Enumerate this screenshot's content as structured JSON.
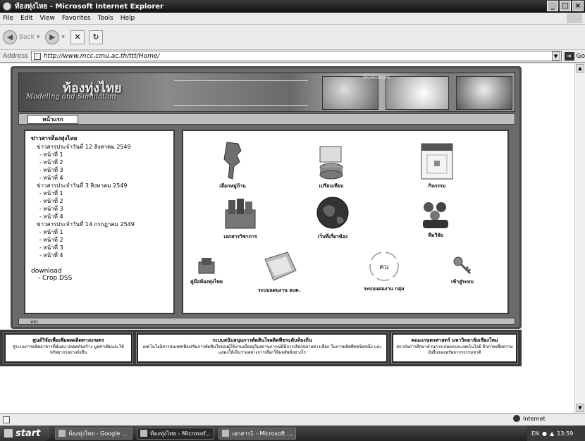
{
  "window": {
    "title": "ท้องทุ่งไทย - Microsoft Internet Explorer",
    "controls": [
      "_",
      "□",
      "×"
    ]
  },
  "menu": [
    "File",
    "Edit",
    "View",
    "Favorites",
    "Tools",
    "Help"
  ],
  "toolbar": {
    "back_label": "Back",
    "forward_label": ""
  },
  "address": {
    "label": "Address",
    "url": "http://www.mcc.cmu.ac.th/ttt/Home/",
    "go_label": "Go"
  },
  "site": {
    "banner_title": "ท้องทุ่งไทย",
    "banner_subtitle": "Modeling and Simulation",
    "banner_tag": "WORKSHOPS",
    "nav_home": "หน้าแรก",
    "news_title": "ข่าวสารท้องทุ่งไทย",
    "news": [
      {
        "issue": "ข่าวสารประจำวันที่ 12 สิงหาคม 2549",
        "pages": [
          "- หน้าที่ 1",
          "- หน้าที่ 2",
          "- หน้าที่ 3",
          "- หน้าที่ 4"
        ]
      },
      {
        "issue": "ข่าวสารประจำวันที่ 3 สิงหาคม 2549",
        "pages": [
          "- หน้าที่ 1",
          "- หน้าที่ 2",
          "- หน้าที่ 3",
          "- หน้าที่ 4"
        ]
      },
      {
        "issue": "ข่าวสารประจำวันที่ 14 กรกฎาคม 2549",
        "pages": [
          "- หน้าที่ 1",
          "- หน้าที่ 2",
          "- หน้าที่ 3",
          "- หน้าที่ 4"
        ]
      }
    ],
    "download_title": "download",
    "download_items": [
      "- Crop DSS"
    ],
    "icons": [
      {
        "label": "เลือกหมู่บ้าน",
        "icon": "thailand-map-icon"
      },
      {
        "label": "เปรียบเทียบ",
        "icon": "database-icon"
      },
      {
        "label": "กิจกรรม",
        "icon": "calendar-icon"
      },
      {
        "label": "เอกสารวิชาการ",
        "icon": "books-icon"
      },
      {
        "label": "เว็บที่เกี่ยวข้อง",
        "icon": "globe-icon"
      },
      {
        "label": "ทีมวิจัย",
        "icon": "team-icon"
      },
      {
        "label": "คู่มือท้องทุ่งไทย",
        "icon": "manual-icon"
      },
      {
        "label": "ระบบแผนงาน อบต.",
        "icon": "folder-icon"
      },
      {
        "label": "ระบบแผนงาน กลุ่ม",
        "icon": "cycle-icon"
      },
      {
        "label": "เข้าสู่ระบบ",
        "icon": "key-icon"
      }
    ],
    "cycle_text": "คน",
    "bottom_strip": "หน้า"
  },
  "footer": [
    {
      "title": "ศูนย์วิจัยเพื่อเพิ่มผลผลิตทางเกษตร",
      "desc": "สู่ระบบการผลิตอาหารที่มั่นคง ปลอดภัยสร้าง มูลค่าเพิ่มและใช้ทรัพยากรอย่างยั่งยืน"
    },
    {
      "title": "ระบบสนับสนุนการตัดสินใจผลิตพืชระดับท้องถิ่น",
      "desc": "เทคโนโลยีสารสนเทศเพื่อเสริมการตัดสินใจของผู้ใช้งานเมื่ออยู่ในสถานการณ์ที่มีการเลือกหลายทางเลือก ในการผลิตพืชชนิดหนึ่ง และแสดงให้เห็นว่าผลต่างการเลือกให้ผลลัพท์อย่างไร"
    },
    {
      "title": "คณะเกษตรศาสตร์ มหาวิทยาลัยเชียงใหม่",
      "desc": "สถาบันการศึกษาด้านการเกษตรและเทคโนโลยี ชีวภาพเพื่อความยั่งยืนของทรัพยากรธรรมชาติ"
    }
  ],
  "status": {
    "zone": "Internet"
  },
  "taskbar": {
    "start": "start",
    "tasks": [
      "ท้องทุ่งไทย - Google ...",
      "ท้องทุ่งไทย - Microsof...",
      "เอกสาร1 - Microsoft ..."
    ],
    "tray_lang": "EN",
    "clock": "13:59"
  }
}
